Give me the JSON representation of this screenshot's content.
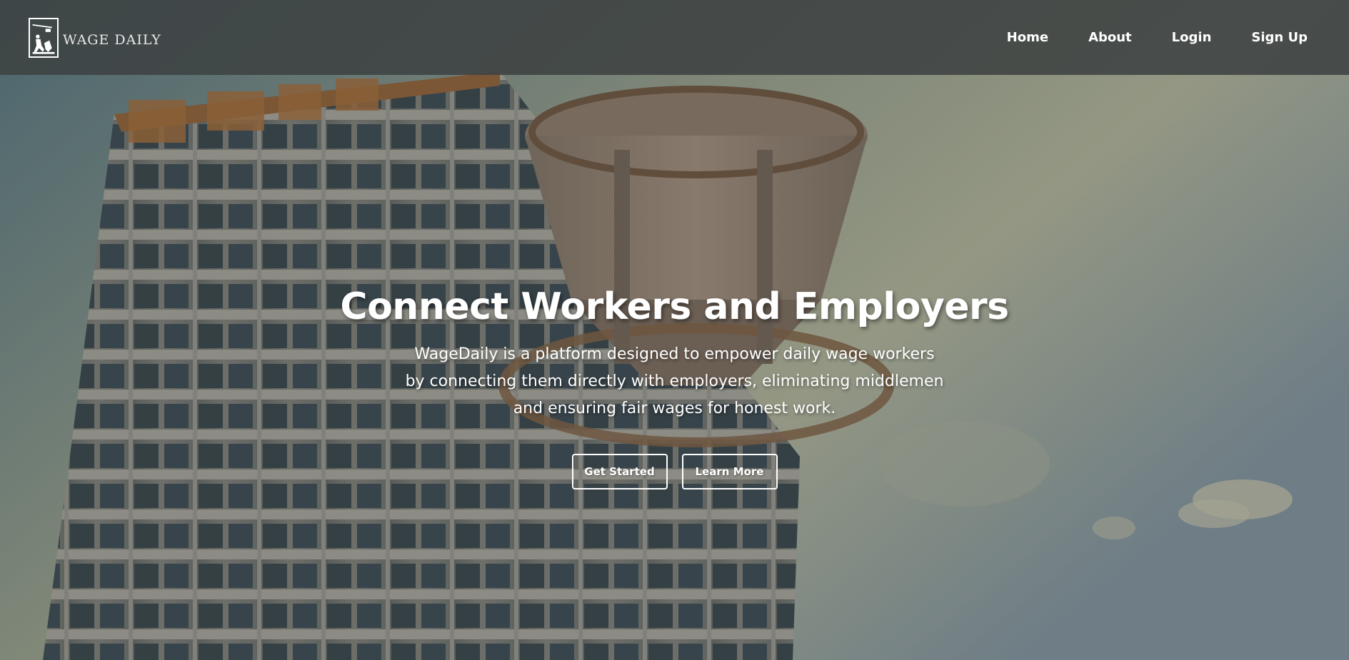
{
  "brand": {
    "name": "WAGE DAILY",
    "logo_icon": "worker-silhouette-icon"
  },
  "nav": {
    "items": [
      {
        "label": "Home"
      },
      {
        "label": "About"
      },
      {
        "label": "Login"
      },
      {
        "label": "Sign Up"
      }
    ]
  },
  "hero": {
    "title": "Connect Workers and Employers",
    "description": "WageDaily is a platform designed to empower daily wage workers by connecting them directly with employers, eliminating middlemen and ensuring fair wages for honest work.",
    "buttons": {
      "primary_label": "Get Started",
      "secondary_label": "Learn More"
    },
    "background": "construction-site-image"
  },
  "colors": {
    "navbar_bg": "#3e4242",
    "text": "#ffffff",
    "button_border": "#ffffff"
  }
}
